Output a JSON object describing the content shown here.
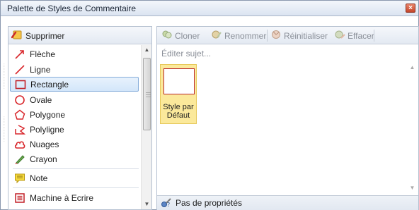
{
  "window": {
    "title": "Palette de Styles de Commentaire",
    "close_glyph": "×"
  },
  "left_toolbar": {
    "delete_label": "Supprimer"
  },
  "tools": [
    {
      "label": "Flèche",
      "icon": "arrow-icon"
    },
    {
      "label": "Ligne",
      "icon": "line-icon"
    },
    {
      "label": "Rectangle",
      "icon": "rectangle-icon",
      "selected": true
    },
    {
      "label": "Ovale",
      "icon": "oval-icon"
    },
    {
      "label": "Polygone",
      "icon": "polygon-icon"
    },
    {
      "label": "Polyligne",
      "icon": "polyline-icon"
    },
    {
      "label": "Nuages",
      "icon": "cloud-icon"
    },
    {
      "label": "Crayon",
      "icon": "pencil-icon"
    },
    {
      "label": "Note",
      "icon": "note-icon"
    },
    {
      "label": "Machine à Ecrire",
      "icon": "typewriter-icon"
    }
  ],
  "right_toolbar": {
    "clone_label": "Cloner",
    "rename_label": "Renommer",
    "reset_label": "Réinitialiser",
    "erase_label": "Effacer"
  },
  "subject_placeholder": "Éditer sujet...",
  "style_card": {
    "label_line1": "Style par",
    "label_line2": "Défaut"
  },
  "statusbar": {
    "text": "Pas de propriétés"
  },
  "colors": {
    "accent_red": "#b8232a",
    "selection_yellow": "#fbe99b",
    "selection_blue": "#d3e6fa"
  }
}
